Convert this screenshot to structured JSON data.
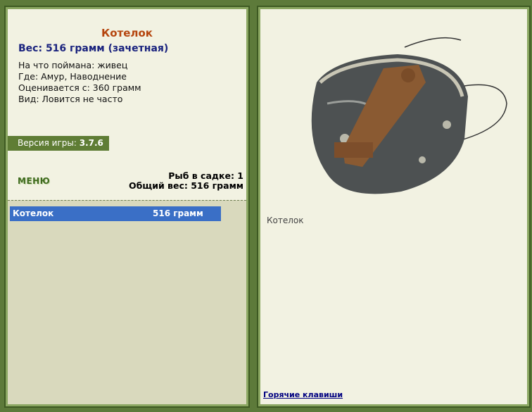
{
  "fish": {
    "name": "Котелок",
    "weight_line": "Вес: 516 грамм (зачетная)",
    "caught_on": "На что поймана: живец",
    "location": "Где: Амур, Наводнение",
    "rated_from": "Оценивается с: 360 грамм",
    "kind": "Вид: Ловится не часто"
  },
  "version": {
    "label": "Версия игры: ",
    "value": "3.7.6"
  },
  "menu_label": "МЕНЮ",
  "keepnet": {
    "count_line": "Рыб в садке: 1",
    "total_line": "Общий вес: 516 грамм",
    "items": [
      {
        "name": "Котелок",
        "weight": "516 грамм"
      }
    ]
  },
  "viewer": {
    "caption": "Котелок",
    "icon": "mess-tin-image"
  },
  "hotkeys_link": "Горячие клавиши",
  "colors": {
    "title": "#b5450e",
    "weight": "#1a237e",
    "selected_row": "#3a6fc6",
    "version_bar": "#5f7d35",
    "panel_bg": "#f2f2e2",
    "list_bg": "#d9d9bd"
  }
}
